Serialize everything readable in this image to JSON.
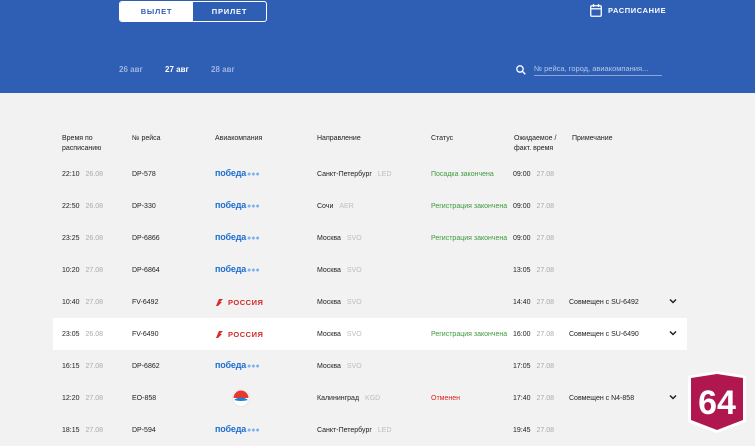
{
  "tabs": {
    "departure": "ВЫЛЕТ",
    "arrival": "ПРИЛЕТ"
  },
  "schedule_label": "РАСПИСАНИЕ",
  "dates": [
    "26 авг",
    "27 авг",
    "28 авг"
  ],
  "search": {
    "placeholder": "№ рейса, город, авиакомпания..."
  },
  "columns": {
    "time": "Время по расписанию",
    "flight": "№ рейса",
    "airline": "Авиакомпания",
    "direction": "Направление",
    "status": "Статус",
    "expected": "Ожидаемое / факт. время",
    "note": "Примечание"
  },
  "rows": [
    {
      "time": "22:10",
      "date": "26.08",
      "flight": "DP-578",
      "airline": "pobeda",
      "city": "Санкт-Петербург",
      "code": "LED",
      "status": "Посадка закончена",
      "exp_time": "09:00",
      "exp_date": "27.08",
      "note": ""
    },
    {
      "time": "22:50",
      "date": "26.08",
      "flight": "DP-330",
      "airline": "pobeda",
      "city": "Сочи",
      "code": "AER",
      "status": "Регистрация закончена",
      "exp_time": "09:00",
      "exp_date": "27.08",
      "note": ""
    },
    {
      "time": "23:25",
      "date": "26.08",
      "flight": "DP-6866",
      "airline": "pobeda",
      "city": "Москва",
      "code": "SVO",
      "status": "Регистрация закончена",
      "exp_time": "09:00",
      "exp_date": "27.08",
      "note": ""
    },
    {
      "time": "10:20",
      "date": "27.08",
      "flight": "DP-6864",
      "airline": "pobeda",
      "city": "Москва",
      "code": "SVO",
      "status": "",
      "exp_time": "13:05",
      "exp_date": "27.08",
      "note": ""
    },
    {
      "time": "10:40",
      "date": "27.08",
      "flight": "FV-6492",
      "airline": "rossiya",
      "city": "Москва",
      "code": "SVO",
      "status": "",
      "exp_time": "14:40",
      "exp_date": "27.08",
      "note": "Совмещен с SU-6492"
    },
    {
      "time": "23:05",
      "date": "26.08",
      "flight": "FV-6490",
      "airline": "rossiya",
      "city": "Москва",
      "code": "SVO",
      "status": "Регистрация закончена",
      "exp_time": "16:00",
      "exp_date": "27.08",
      "note": "Совмещен с SU-6490"
    },
    {
      "time": "16:15",
      "date": "27.08",
      "flight": "DP-6862",
      "airline": "pobeda",
      "city": "Москва",
      "code": "SVO",
      "status": "",
      "exp_time": "17:05",
      "exp_date": "27.08",
      "note": ""
    },
    {
      "time": "12:20",
      "date": "27.08",
      "flight": "EO-858",
      "airline": "pegas",
      "city": "Калининград",
      "code": "KGD",
      "status": "Отменен",
      "exp_time": "17:40",
      "exp_date": "27.08",
      "note": "Совмещен с N4-858"
    },
    {
      "time": "18:15",
      "date": "27.08",
      "flight": "DP-594",
      "airline": "pobeda",
      "city": "Санкт-Петербург",
      "code": "LED",
      "status": "",
      "exp_time": "19:45",
      "exp_date": "27.08",
      "note": ""
    }
  ],
  "logos": {
    "pobeda": "победа",
    "rossiya": "РОССИЯ"
  },
  "badge": "64",
  "colors": {
    "header": "#2e5fb4",
    "status_ok": "#3d9a3d",
    "status_cancel": "#dd2222",
    "badge": "#b0174f"
  }
}
